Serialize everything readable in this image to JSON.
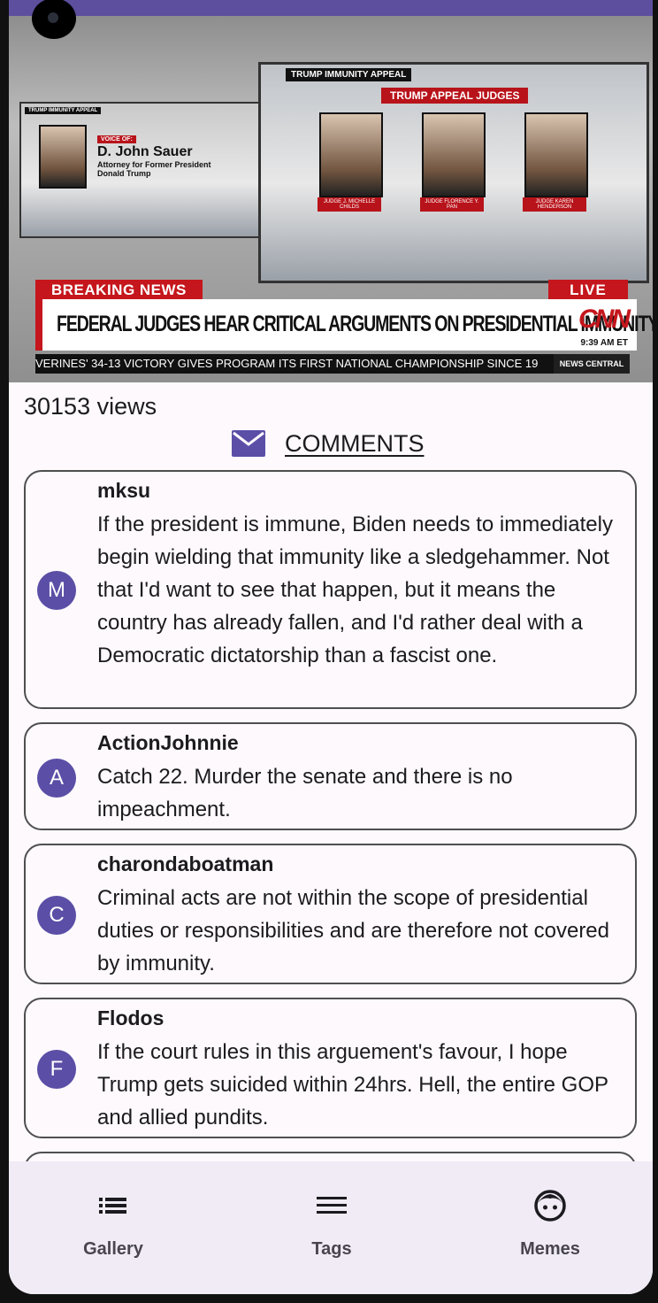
{
  "status_bar": {
    "left_text": "",
    "right_text": ""
  },
  "video": {
    "left_tag": "TRUMP IMMUNITY APPEAL",
    "voice_of": "VOICE OF:",
    "speaker_name": "D. John Sauer",
    "speaker_title": "Attorney for Former President Donald Trump",
    "right_tag": "TRUMP IMMUNITY APPEAL",
    "judges_tag": "TRUMP APPEAL JUDGES",
    "judges": [
      "JUDGE J. MICHELLE CHILDS",
      "JUDGE FLORENCE Y. PAN",
      "JUDGE KAREN HENDERSON"
    ],
    "breaking": "BREAKING NEWS",
    "live": "LIVE",
    "headline": "FEDERAL JUDGES HEAR CRITICAL ARGUMENTS ON PRESIDENTIAL IMMUNITY",
    "network": "CNN",
    "time": "9:39 AM ET",
    "ticker": "VERINES' 34-13 VICTORY GIVES PROGRAM ITS FIRST NATIONAL CHAMPIONSHIP SINCE 19",
    "ticker_tag": "NEWS CENTRAL"
  },
  "views": "30153 views",
  "comments_title": "COMMENTS",
  "comments": [
    {
      "initial": "M",
      "author": "mksu",
      "text": "If the president is immune, Biden needs to immediately begin wielding that immunity like a sledgehammer. Not that I'd want to see that happen, but it means the country has already fallen, and I'd rather deal with a Democratic dictatorship than a fascist one."
    },
    {
      "initial": "A",
      "author": "ActionJohnnie",
      "text": "Catch 22. Murder the senate and there is no impeachment."
    },
    {
      "initial": "C",
      "author": "charondaboatman",
      "text": "Criminal acts are not within the scope of presidential duties or responsibilities and are therefore not covered by immunity."
    },
    {
      "initial": "F",
      "author": "Flodos",
      "text": "If the court rules in this arguement's favour, I hope Trump gets suicided within 24hrs. Hell, the entire GOP and allied pundits."
    }
  ],
  "bottom_nav": [
    {
      "label": "Gallery",
      "icon": "list-icon"
    },
    {
      "label": "Tags",
      "icon": "menu-lines-icon"
    },
    {
      "label": "Memes",
      "icon": "face-icon"
    }
  ],
  "colors": {
    "accent": "#5b4ea6",
    "status_bar": "#5d4f9e",
    "breaking_red": "#c4161c"
  }
}
